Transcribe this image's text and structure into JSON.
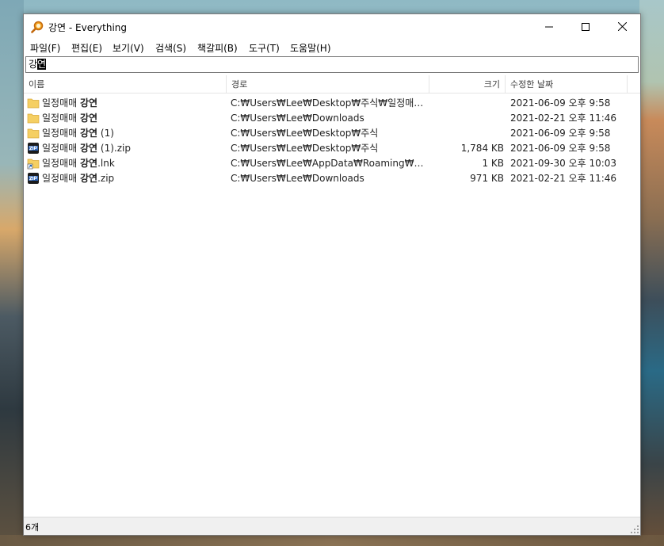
{
  "window": {
    "title": "강연 - Everything"
  },
  "menu": [
    {
      "label": "파일(F)"
    },
    {
      "label": "편집(E)"
    },
    {
      "label": "보기(V)"
    },
    {
      "label": "검색(S)"
    },
    {
      "label": "책갈피(B)"
    },
    {
      "label": "도구(T)"
    },
    {
      "label": "도움말(H)"
    }
  ],
  "search": {
    "value_plain": "강",
    "value_selected": "연"
  },
  "columns": {
    "name": "이름",
    "path": "경로",
    "size": "크기",
    "date": "수정한 날짜"
  },
  "files": [
    {
      "name_prefix": "일정매매 ",
      "name_bold": "강연",
      "name_suffix": "",
      "type": "folder",
      "path": "C:₩Users₩Lee₩Desktop₩주식₩일정매매 강...",
      "size": "",
      "date": "2021-06-09 오후 9:58"
    },
    {
      "name_prefix": "일정매매 ",
      "name_bold": "강연",
      "name_suffix": "",
      "type": "folder",
      "path": "C:₩Users₩Lee₩Downloads",
      "size": "",
      "date": "2021-02-21 오후 11:46"
    },
    {
      "name_prefix": "일정매매 ",
      "name_bold": "강연",
      "name_suffix": " (1)",
      "type": "folder",
      "path": "C:₩Users₩Lee₩Desktop₩주식",
      "size": "",
      "date": "2021-06-09 오후 9:58"
    },
    {
      "name_prefix": "일정매매 ",
      "name_bold": "강연",
      "name_suffix": " (1).zip",
      "type": "zip",
      "path": "C:₩Users₩Lee₩Desktop₩주식",
      "size": "1,784 KB",
      "date": "2021-06-09 오후 9:58"
    },
    {
      "name_prefix": "일정매매 ",
      "name_bold": "강연",
      "name_suffix": ".lnk",
      "type": "shortcut",
      "path": "C:₩Users₩Lee₩AppData₩Roaming₩Micros...",
      "size": "1 KB",
      "date": "2021-09-30 오후 10:03"
    },
    {
      "name_prefix": "일정매매 ",
      "name_bold": "강연",
      "name_suffix": ".zip",
      "type": "zip",
      "path": "C:₩Users₩Lee₩Downloads",
      "size": "971 KB",
      "date": "2021-02-21 오후 11:46"
    }
  ],
  "status": {
    "count": "6개"
  },
  "colors": {
    "folder": "#f5cf63",
    "accent_orange": "#e8801a"
  }
}
